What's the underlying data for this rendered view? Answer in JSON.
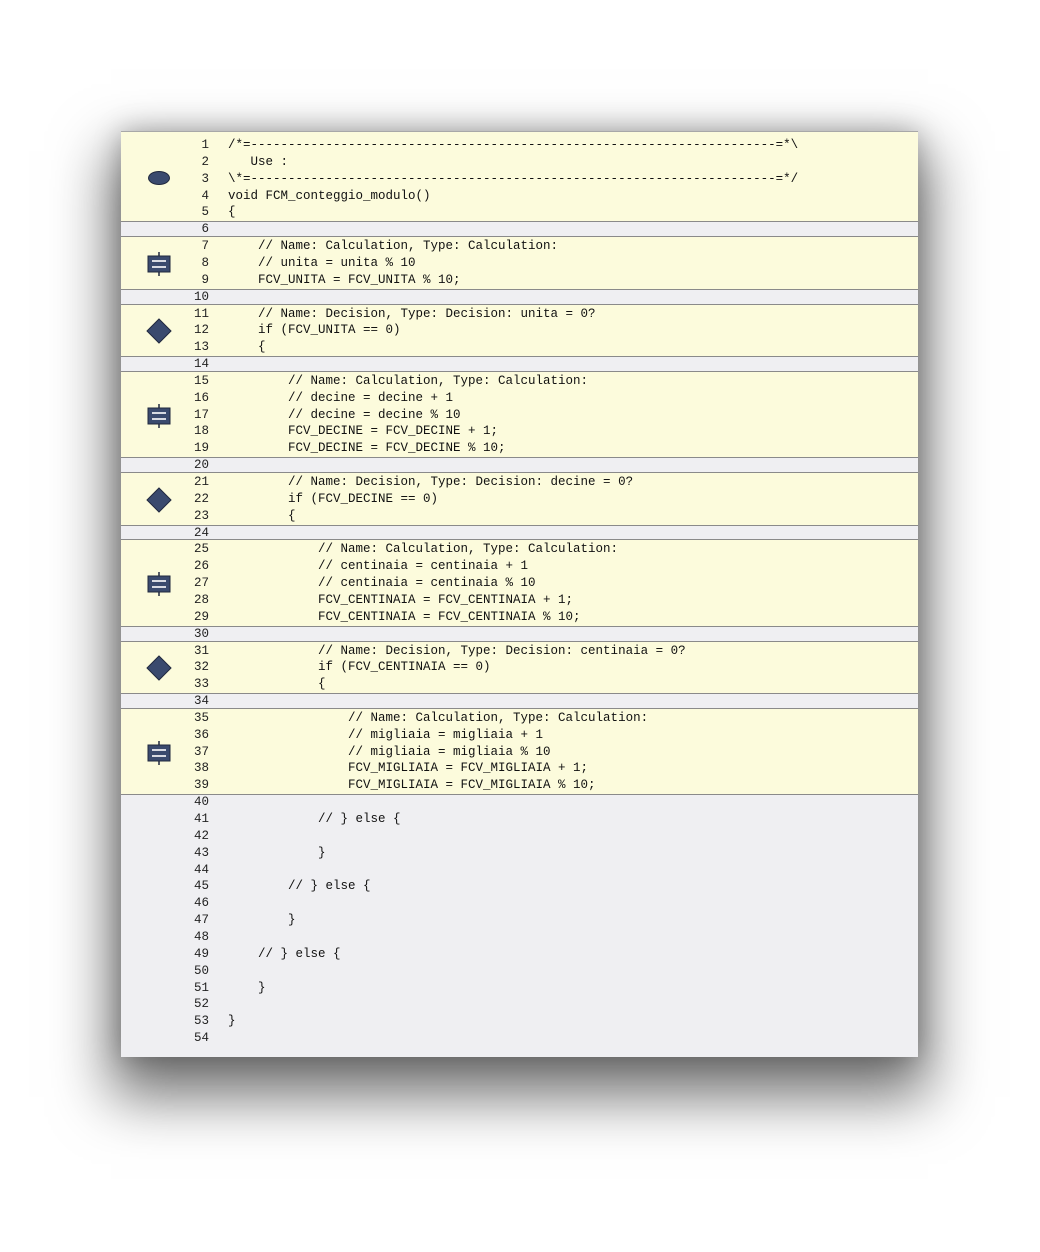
{
  "lines": [
    {
      "n": "1",
      "t": "/*=----------------------------------------------------------------------=*\\"
    },
    {
      "n": "2",
      "t": "   Use :"
    },
    {
      "n": "3",
      "t": "\\*=----------------------------------------------------------------------=*/"
    },
    {
      "n": "4",
      "t": "void FCM_conteggio_modulo()"
    },
    {
      "n": "5",
      "t": "{"
    },
    {
      "n": "6",
      "t": ""
    },
    {
      "n": "7",
      "t": "    // Name: Calculation, Type: Calculation:"
    },
    {
      "n": "8",
      "t": "    // unita = unita % 10"
    },
    {
      "n": "9",
      "t": "    FCV_UNITA = FCV_UNITA % 10;"
    },
    {
      "n": "10",
      "t": ""
    },
    {
      "n": "11",
      "t": "    // Name: Decision, Type: Decision: unita = 0?"
    },
    {
      "n": "12",
      "t": "    if (FCV_UNITA == 0)"
    },
    {
      "n": "13",
      "t": "    {"
    },
    {
      "n": "14",
      "t": ""
    },
    {
      "n": "15",
      "t": "        // Name: Calculation, Type: Calculation:"
    },
    {
      "n": "16",
      "t": "        // decine = decine + 1"
    },
    {
      "n": "17",
      "t": "        // decine = decine % 10"
    },
    {
      "n": "18",
      "t": "        FCV_DECINE = FCV_DECINE + 1;"
    },
    {
      "n": "19",
      "t": "        FCV_DECINE = FCV_DECINE % 10;"
    },
    {
      "n": "20",
      "t": ""
    },
    {
      "n": "21",
      "t": "        // Name: Decision, Type: Decision: decine = 0?"
    },
    {
      "n": "22",
      "t": "        if (FCV_DECINE == 0)"
    },
    {
      "n": "23",
      "t": "        {"
    },
    {
      "n": "24",
      "t": ""
    },
    {
      "n": "25",
      "t": "            // Name: Calculation, Type: Calculation:"
    },
    {
      "n": "26",
      "t": "            // centinaia = centinaia + 1"
    },
    {
      "n": "27",
      "t": "            // centinaia = centinaia % 10"
    },
    {
      "n": "28",
      "t": "            FCV_CENTINAIA = FCV_CENTINAIA + 1;"
    },
    {
      "n": "29",
      "t": "            FCV_CENTINAIA = FCV_CENTINAIA % 10;"
    },
    {
      "n": "30",
      "t": ""
    },
    {
      "n": "31",
      "t": "            // Name: Decision, Type: Decision: centinaia = 0?"
    },
    {
      "n": "32",
      "t": "            if (FCV_CENTINAIA == 0)"
    },
    {
      "n": "33",
      "t": "            {"
    },
    {
      "n": "34",
      "t": ""
    },
    {
      "n": "35",
      "t": "                // Name: Calculation, Type: Calculation:"
    },
    {
      "n": "36",
      "t": "                // migliaia = migliaia + 1"
    },
    {
      "n": "37",
      "t": "                // migliaia = migliaia % 10"
    },
    {
      "n": "38",
      "t": "                FCV_MIGLIAIA = FCV_MIGLIAIA + 1;"
    },
    {
      "n": "39",
      "t": "                FCV_MIGLIAIA = FCV_MIGLIAIA % 10;"
    },
    {
      "n": "40",
      "t": ""
    },
    {
      "n": "41",
      "t": "            // } else {"
    },
    {
      "n": "42",
      "t": ""
    },
    {
      "n": "43",
      "t": "            }"
    },
    {
      "n": "44",
      "t": ""
    },
    {
      "n": "45",
      "t": "        // } else {"
    },
    {
      "n": "46",
      "t": ""
    },
    {
      "n": "47",
      "t": "        }"
    },
    {
      "n": "48",
      "t": ""
    },
    {
      "n": "49",
      "t": "    // } else {"
    },
    {
      "n": "50",
      "t": ""
    },
    {
      "n": "51",
      "t": "    }"
    },
    {
      "n": "52",
      "t": ""
    },
    {
      "n": "53",
      "t": "}"
    },
    {
      "n": "54",
      "t": ""
    }
  ],
  "blocks": [
    {
      "type": "terminator",
      "icon": "oval-terminator-icon",
      "from": 1,
      "to": 5
    },
    {
      "type": "calculation",
      "icon": "calculation-block-icon",
      "from": 7,
      "to": 9
    },
    {
      "type": "decision",
      "icon": "decision-diamond-icon",
      "from": 11,
      "to": 13
    },
    {
      "type": "calculation",
      "icon": "calculation-block-icon",
      "from": 15,
      "to": 19
    },
    {
      "type": "decision",
      "icon": "decision-diamond-icon",
      "from": 21,
      "to": 23
    },
    {
      "type": "calculation",
      "icon": "calculation-block-icon",
      "from": 25,
      "to": 29
    },
    {
      "type": "decision",
      "icon": "decision-diamond-icon",
      "from": 31,
      "to": 33
    },
    {
      "type": "calculation",
      "icon": "calculation-block-icon",
      "from": 35,
      "to": 39
    }
  ],
  "colors": {
    "block_bg": "#fcfbdc",
    "window_bg": "#efeff2",
    "icon": "#3a4a6e"
  }
}
